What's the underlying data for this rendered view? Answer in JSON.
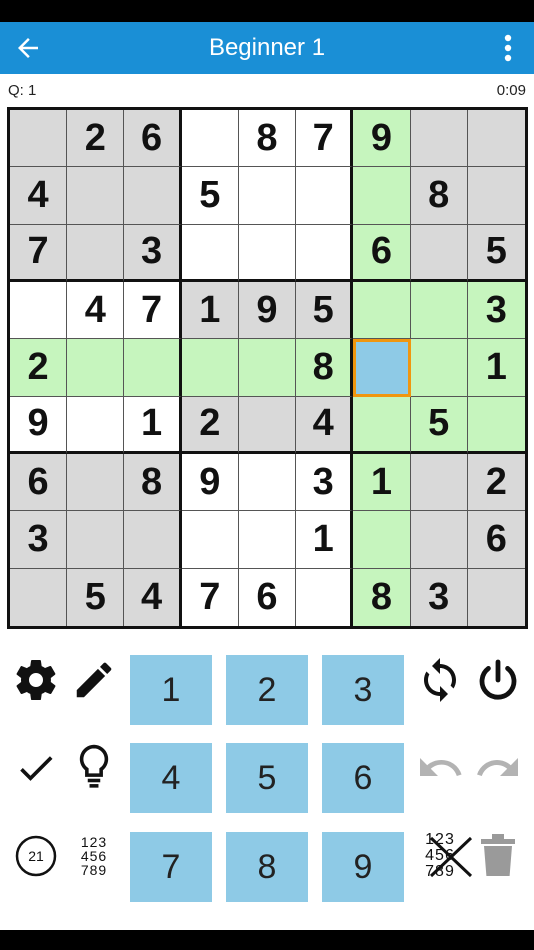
{
  "header": {
    "title": "Beginner  1",
    "back_icon": "arrow-left-icon",
    "menu_icon": "more-vertical-icon"
  },
  "info": {
    "question": "Q: 1",
    "timer": "0:09"
  },
  "grid": {
    "cells": [
      [
        {
          "v": "",
          "c": "gray"
        },
        {
          "v": "2",
          "c": "gray"
        },
        {
          "v": "6",
          "c": "gray"
        },
        {
          "v": "",
          "c": "white"
        },
        {
          "v": "8",
          "c": "white"
        },
        {
          "v": "7",
          "c": "white"
        },
        {
          "v": "9",
          "c": "green"
        },
        {
          "v": "",
          "c": "gray"
        },
        {
          "v": "",
          "c": "gray"
        }
      ],
      [
        {
          "v": "4",
          "c": "gray"
        },
        {
          "v": "",
          "c": "gray"
        },
        {
          "v": "",
          "c": "gray"
        },
        {
          "v": "5",
          "c": "white"
        },
        {
          "v": "",
          "c": "white"
        },
        {
          "v": "",
          "c": "white"
        },
        {
          "v": "",
          "c": "green"
        },
        {
          "v": "8",
          "c": "gray"
        },
        {
          "v": "",
          "c": "gray"
        }
      ],
      [
        {
          "v": "7",
          "c": "gray"
        },
        {
          "v": "",
          "c": "gray"
        },
        {
          "v": "3",
          "c": "gray"
        },
        {
          "v": "",
          "c": "white"
        },
        {
          "v": "",
          "c": "white"
        },
        {
          "v": "",
          "c": "white"
        },
        {
          "v": "6",
          "c": "green"
        },
        {
          "v": "",
          "c": "gray"
        },
        {
          "v": "5",
          "c": "gray"
        }
      ],
      [
        {
          "v": "",
          "c": "white"
        },
        {
          "v": "4",
          "c": "white"
        },
        {
          "v": "7",
          "c": "white"
        },
        {
          "v": "1",
          "c": "gray"
        },
        {
          "v": "9",
          "c": "gray"
        },
        {
          "v": "5",
          "c": "gray"
        },
        {
          "v": "",
          "c": "green"
        },
        {
          "v": "",
          "c": "green"
        },
        {
          "v": "3",
          "c": "green"
        }
      ],
      [
        {
          "v": "2",
          "c": "green"
        },
        {
          "v": "",
          "c": "green"
        },
        {
          "v": "",
          "c": "green"
        },
        {
          "v": "",
          "c": "green"
        },
        {
          "v": "",
          "c": "green"
        },
        {
          "v": "8",
          "c": "green"
        },
        {
          "v": "",
          "c": "sel"
        },
        {
          "v": "",
          "c": "green"
        },
        {
          "v": "1",
          "c": "green"
        }
      ],
      [
        {
          "v": "9",
          "c": "white"
        },
        {
          "v": "",
          "c": "white"
        },
        {
          "v": "1",
          "c": "white"
        },
        {
          "v": "2",
          "c": "gray"
        },
        {
          "v": "",
          "c": "gray"
        },
        {
          "v": "4",
          "c": "gray"
        },
        {
          "v": "",
          "c": "green"
        },
        {
          "v": "5",
          "c": "green"
        },
        {
          "v": "",
          "c": "green"
        }
      ],
      [
        {
          "v": "6",
          "c": "gray"
        },
        {
          "v": "",
          "c": "gray"
        },
        {
          "v": "8",
          "c": "gray"
        },
        {
          "v": "9",
          "c": "white"
        },
        {
          "v": "",
          "c": "white"
        },
        {
          "v": "3",
          "c": "white"
        },
        {
          "v": "1",
          "c": "green"
        },
        {
          "v": "",
          "c": "gray"
        },
        {
          "v": "2",
          "c": "gray"
        }
      ],
      [
        {
          "v": "3",
          "c": "gray"
        },
        {
          "v": "",
          "c": "gray"
        },
        {
          "v": "",
          "c": "gray"
        },
        {
          "v": "",
          "c": "white"
        },
        {
          "v": "",
          "c": "white"
        },
        {
          "v": "1",
          "c": "white"
        },
        {
          "v": "",
          "c": "green"
        },
        {
          "v": "",
          "c": "gray"
        },
        {
          "v": "6",
          "c": "gray"
        }
      ],
      [
        {
          "v": "",
          "c": "gray"
        },
        {
          "v": "5",
          "c": "gray"
        },
        {
          "v": "4",
          "c": "gray"
        },
        {
          "v": "7",
          "c": "white"
        },
        {
          "v": "6",
          "c": "white"
        },
        {
          "v": "",
          "c": "white"
        },
        {
          "v": "8",
          "c": "green"
        },
        {
          "v": "3",
          "c": "gray"
        },
        {
          "v": "",
          "c": "gray"
        }
      ]
    ]
  },
  "keypad": {
    "keys": [
      "1",
      "2",
      "3",
      "4",
      "5",
      "6",
      "7",
      "8",
      "9"
    ]
  },
  "tools": {
    "counter_value": "21",
    "mini_grid_rows": [
      "123",
      "456",
      "789"
    ],
    "icons": [
      "gear-icon",
      "pencil-icon",
      "check-icon",
      "lightbulb-icon",
      "counter-icon",
      "candidates-icon",
      "refresh-icon",
      "power-icon",
      "undo-icon",
      "redo-icon",
      "clear-candidates-icon",
      "trash-icon"
    ]
  },
  "colors": {
    "app_bar": "#1a8fd6",
    "gray_cell": "#d9d9d9",
    "green_cell": "#c6f5be",
    "selected_cell": "#8ecae6",
    "selected_border": "#f0960f",
    "key": "#8ecae6"
  }
}
